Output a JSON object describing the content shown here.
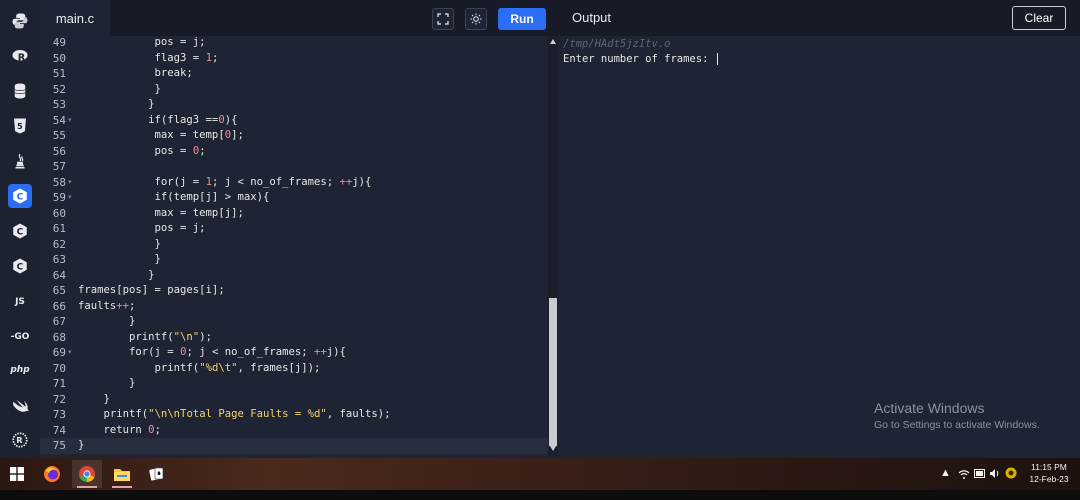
{
  "sidebar": {
    "languages": [
      "python",
      "r",
      "sql",
      "html",
      "java",
      "c",
      "cpp",
      "csharp",
      "js",
      "go",
      "php",
      "swift",
      "rust"
    ],
    "active": "c",
    "js_label": "JS",
    "go_label": "-GO",
    "php_label": "php"
  },
  "editor": {
    "file_tab": "main.c",
    "run_label": "Run",
    "lines": [
      {
        "num": "49",
        "code": "            pos = j;"
      },
      {
        "num": "50",
        "code": "            flag3 = 1;"
      },
      {
        "num": "51",
        "code": "            break;"
      },
      {
        "num": "52",
        "code": "            }"
      },
      {
        "num": "53",
        "code": "           }"
      },
      {
        "num": "54",
        "code": "           if(flag3 ==0){"
      },
      {
        "num": "55",
        "code": "            max = temp[0];"
      },
      {
        "num": "56",
        "code": "            pos = 0;"
      },
      {
        "num": "57",
        "code": ""
      },
      {
        "num": "58",
        "code": "            for(j = 1; j < no_of_frames; ++j){"
      },
      {
        "num": "59",
        "code": "            if(temp[j] > max){"
      },
      {
        "num": "60",
        "code": "            max = temp[j];"
      },
      {
        "num": "61",
        "code": "            pos = j;"
      },
      {
        "num": "62",
        "code": "            }"
      },
      {
        "num": "63",
        "code": "            }"
      },
      {
        "num": "64",
        "code": "           }"
      },
      {
        "num": "65",
        "code": "frames[pos] = pages[i];"
      },
      {
        "num": "66",
        "code": "faults++;"
      },
      {
        "num": "67",
        "code": "        }"
      },
      {
        "num": "68",
        "code": "        printf(\"\\n\");"
      },
      {
        "num": "69",
        "code": "        for(j = 0; j < no_of_frames; ++j){"
      },
      {
        "num": "70",
        "code": "            printf(\"%d\\t\", frames[j]);"
      },
      {
        "num": "71",
        "code": "        }"
      },
      {
        "num": "72",
        "code": "    }"
      },
      {
        "num": "73",
        "code": "    printf(\"\\n\\nTotal Page Faults = %d\", faults);"
      },
      {
        "num": "74",
        "code": "    return 0;"
      },
      {
        "num": "75",
        "code": "}"
      }
    ],
    "fold_lines": [
      "54",
      "58",
      "59",
      "69"
    ],
    "current_line": "75"
  },
  "output": {
    "title": "Output",
    "clear_label": "Clear",
    "path": "/tmp/HAdt5jzItv.o",
    "prompt": "Enter number of frames: "
  },
  "watermark": {
    "title": "Activate Windows",
    "subtitle": "Go to Settings to activate Windows."
  },
  "taskbar": {
    "apps": [
      "windows-start",
      "firefox",
      "chrome",
      "file-explorer",
      "solitaire"
    ],
    "clock_time": "11:15 PM",
    "clock_date": "12-Feb-23"
  },
  "colors": {
    "accent": "#2b6ef3",
    "editor_bg": "#1e2433",
    "number": "#f08a9a",
    "string": "#f5d26a"
  }
}
